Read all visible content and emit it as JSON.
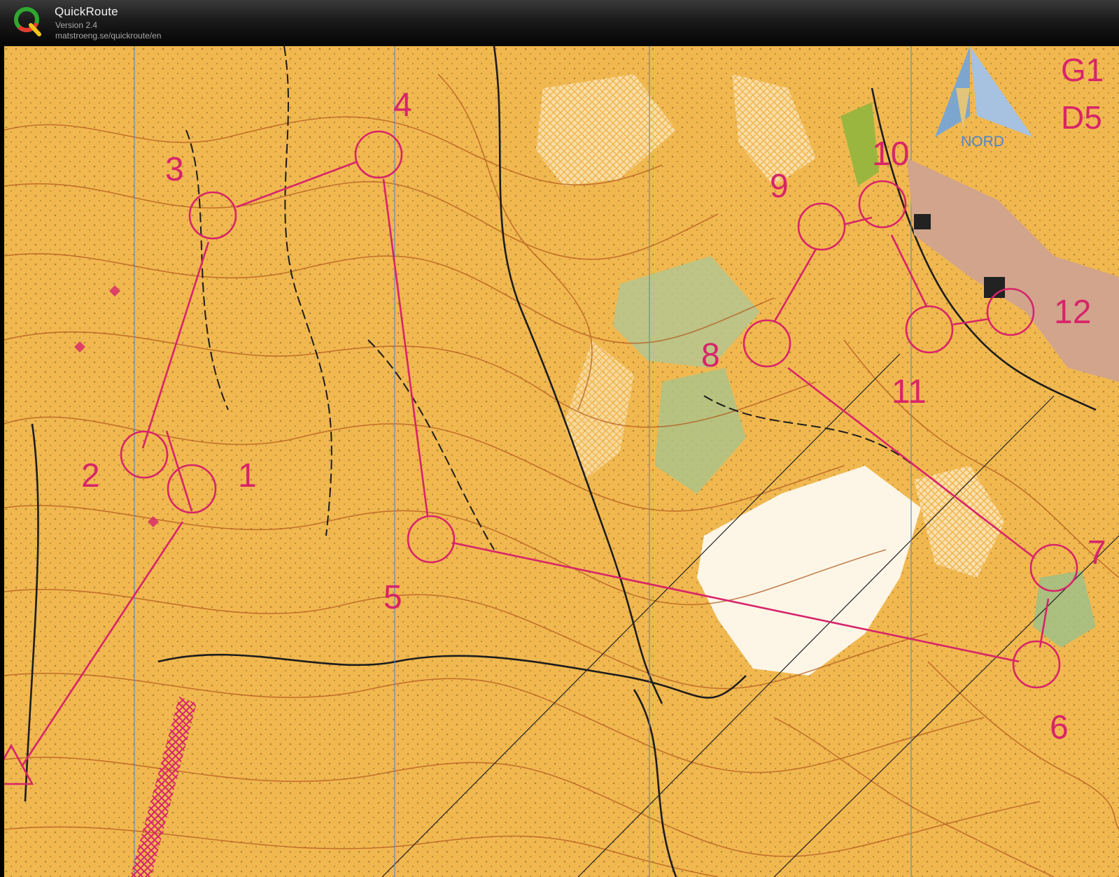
{
  "app": {
    "name": "QuickRoute",
    "version": "Version 2.4",
    "url": "matstroeng.se/quickroute/en"
  },
  "map": {
    "north_label": "NORD",
    "class_labels": [
      "G1",
      "D5"
    ],
    "course_color": "#d8246a",
    "terrain_color": "#f1b84f",
    "controls": [
      {
        "label": "1"
      },
      {
        "label": "2"
      },
      {
        "label": "3"
      },
      {
        "label": "4"
      },
      {
        "label": "5"
      },
      {
        "label": "6"
      },
      {
        "label": "7"
      },
      {
        "label": "8"
      },
      {
        "label": "9"
      },
      {
        "label": "10"
      },
      {
        "label": "11"
      },
      {
        "label": "12"
      }
    ]
  }
}
